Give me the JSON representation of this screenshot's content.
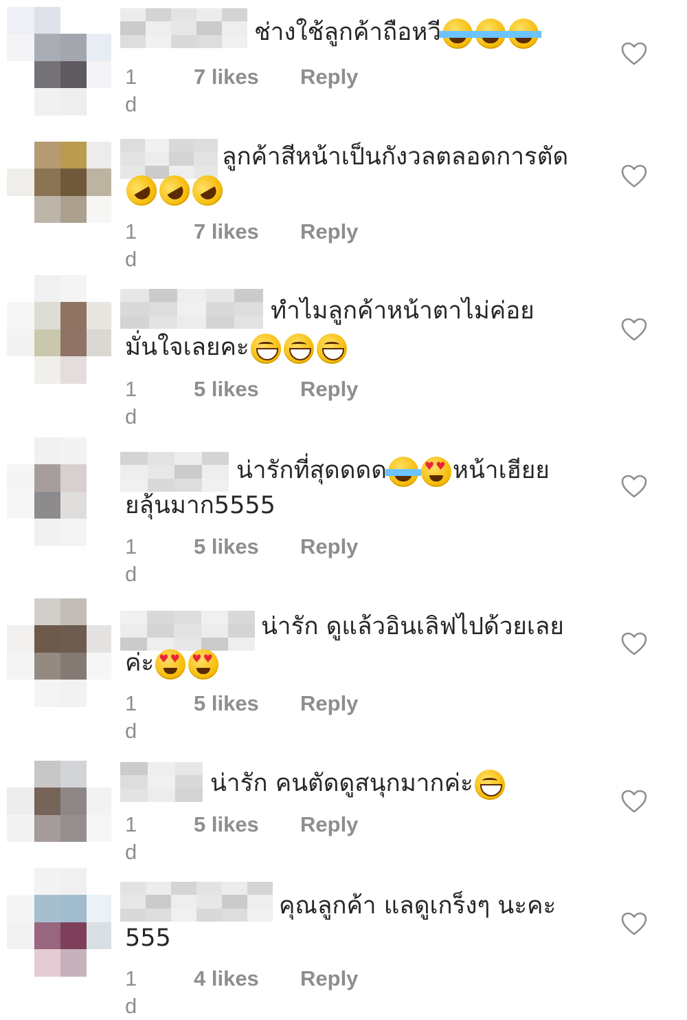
{
  "comments": [
    {
      "text_lines": [
        "ช่างใช้ลูกค้าถือหวี"
      ],
      "emojis_after": [
        "laugh",
        "laugh",
        "laugh"
      ],
      "emojis_line": 0,
      "time": "1 d",
      "likes": "7 likes",
      "reply": "Reply",
      "avatar_colors": [
        "#eef0f5",
        "#dfe2ea",
        "#ffffff",
        "#ffffff",
        "#f4f4f6",
        "#a9adb6",
        "#a4a6ae",
        "#e7edf2",
        "#ffffff",
        "#757277",
        "#5e5a5f",
        "#f4f4f6",
        "#ffffff",
        "#f1f1f3",
        "#eeeeef",
        "#ffffff"
      ]
    },
    {
      "text_lines": [
        "ลูกค้าสีหน้าเป็นกังวลตลอดการตัด"
      ],
      "emojis_after": [
        "rofl",
        "rofl",
        "rofl"
      ],
      "emojis_line": 1,
      "time": "1 d",
      "likes": "7 likes",
      "reply": "Reply",
      "avatar_colors": [
        "#ffffff",
        "#b49b72",
        "#b99c4d",
        "#ececec",
        "#efeeea",
        "#8a7352",
        "#70583a",
        "#bdb3a1",
        "#ffffff",
        "#beb5aa",
        "#ab9f8d",
        "#f6f6f4",
        "#ffffff",
        "#ffffff",
        "#ffffff",
        "#ffffff"
      ]
    },
    {
      "text_lines": [
        "ทำไมลูกค้าหน้าตาไม่ค่อย",
        "มั่นใจเลยคะ"
      ],
      "emojis_after": [
        "grin",
        "grin",
        "grin"
      ],
      "emojis_line": 1,
      "time": "1 d",
      "likes": "5 likes",
      "reply": "Reply",
      "avatar_colors": [
        "#ffffff",
        "#f0f0f0",
        "#f4f4f4",
        "#ffffff",
        "#f6f6f6",
        "#dcdcd5",
        "#8f7363",
        "#e9e5e1",
        "#f3f3f3",
        "#c9c8ac",
        "#8e7366",
        "#dbd7d2",
        "#ffffff",
        "#f1efea",
        "#e3dddc",
        "#ffffff"
      ]
    },
    {
      "text_lines": [
        "น่ารักที่สุดดดด",
        "ยลุ้นมาก5555"
      ],
      "emojis_after": [
        "laugh",
        "hearts"
      ],
      "emojis_line": 0,
      "trailing_text": "หน้าเฮียย",
      "time": "1 d",
      "likes": "5 likes",
      "reply": "Reply",
      "avatar_colors": [
        "#ffffff",
        "#f3f1ef",
        "#f3f3f3",
        "#ffffff",
        "#f5f5f5",
        "#a79e9b",
        "#d8cfd0",
        "#ffffff",
        "#f6f6f6",
        "#8d8b8d",
        "#dfdcdc",
        "#ffffff",
        "#ffffff",
        "#f1f1f1",
        "#f4f4f4",
        "#ffffff"
      ]
    },
    {
      "text_lines": [
        "น่ารัก  ดูแล้วอินเลิฟไปด้วยเลย",
        "ค่ะ"
      ],
      "emojis_after": [
        "hearts",
        "hearts"
      ],
      "emojis_line": 1,
      "time": "1 d",
      "likes": "5 likes",
      "reply": "Reply",
      "avatar_colors": [
        "#ffffff",
        "#d2cec9",
        "#c3bdb7",
        "#ffffff",
        "#f1f0ef",
        "#6e5a4a",
        "#6d5c4f",
        "#e4e2e0",
        "#f4f4f4",
        "#948a82",
        "#857a73",
        "#f6f6f6",
        "#ffffff",
        "#f4f4f4",
        "#f2f2f2",
        "#ffffff"
      ]
    },
    {
      "text_lines": [
        "น่ารัก คนตัดดูสนุกมากค่ะ"
      ],
      "emojis_after": [
        "grin"
      ],
      "emojis_line": 0,
      "time": "1 d",
      "likes": "5 likes",
      "reply": "Reply",
      "avatar_colors": [
        "#ffffff",
        "#c9c6c6",
        "#d3d4d8",
        "#ffffff",
        "#ededed",
        "#766459",
        "#8e8786",
        "#f2f2f2",
        "#f3f3f3",
        "#a49b9a",
        "#958e8e",
        "#f6f6f6",
        "#ffffff",
        "#ffffff",
        "#ffffff",
        "#ffffff"
      ]
    },
    {
      "text_lines": [
        "คุณลูกค้า แลดูเกร็งๆ นะคะ",
        "555"
      ],
      "emojis_after": [],
      "emojis_line": 0,
      "time": "1 d",
      "likes": "4 likes",
      "reply": "Reply",
      "avatar_colors": [
        "#ffffff",
        "#f3f3f3",
        "#f0f0f0",
        "#ffffff",
        "#f5f5f5",
        "#a5bfcf",
        "#a1bccf",
        "#ebf1f4",
        "#f2f2f2",
        "#98667e",
        "#7e3f5b",
        "#d9dfe3",
        "#ffffff",
        "#e4cbd4",
        "#c6b2bb",
        "#ffffff"
      ]
    }
  ]
}
